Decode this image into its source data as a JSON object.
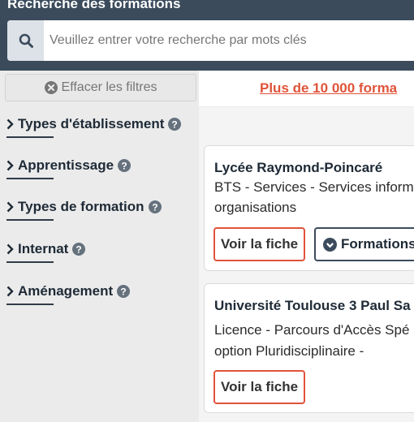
{
  "header": {
    "title": "Recherche des formations",
    "search_placeholder": "Veuillez entrer votre recherche par mots clés"
  },
  "sidebar": {
    "clear_filters_label": "Effacer les filtres",
    "filters": [
      {
        "label": "Types d'établissement"
      },
      {
        "label": "Apprentissage"
      },
      {
        "label": "Types de formation"
      },
      {
        "label": "Internat"
      },
      {
        "label": "Aménagement"
      }
    ]
  },
  "results": {
    "count_label": "Plus de 10 000 forma",
    "cards": [
      {
        "title": "Lycée Raymond-Poincaré",
        "desc_line1": "BTS - Services - Services inform",
        "desc_line2": "organisations",
        "view_label": "Voir la fiche",
        "formations_label": "Formations"
      },
      {
        "title": "Université Toulouse 3 Paul Sa",
        "desc_line1": "Licence - Parcours d'Accès Spé",
        "desc_line2": "option Pluridisciplinaire -",
        "view_label": "Voir la fiche"
      }
    ]
  },
  "colors": {
    "header_bg": "#3b4b5c",
    "accent": "#e0533a",
    "sidebar_bg": "#ebebeb"
  },
  "icons": [
    "search-icon",
    "clear-circle-icon",
    "chevron-right-icon",
    "help-circle-icon",
    "chevron-circle-icon"
  ]
}
